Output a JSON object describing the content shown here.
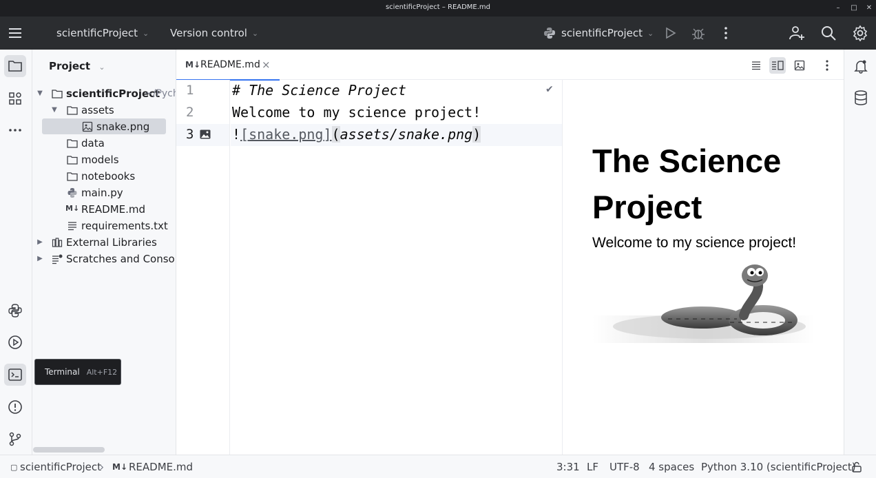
{
  "window": {
    "title": "scientificProject – README.md"
  },
  "toolbar": {
    "project_name": "scientificProject",
    "vcs_label": "Version control",
    "run_config": "scientificProject"
  },
  "project_panel": {
    "title": "Project",
    "root_name": "scientificProject",
    "root_path": "~/PycharmProjects/scientificProject",
    "items": [
      {
        "label": "assets",
        "type": "folder"
      },
      {
        "label": "snake.png",
        "type": "image"
      },
      {
        "label": "data",
        "type": "folder"
      },
      {
        "label": "models",
        "type": "folder"
      },
      {
        "label": "notebooks",
        "type": "folder"
      },
      {
        "label": "main.py",
        "type": "python"
      },
      {
        "label": "README.md",
        "type": "markdown"
      },
      {
        "label": "requirements.txt",
        "type": "text"
      },
      {
        "label": "External Libraries",
        "type": "libraries"
      },
      {
        "label": "Scratches and Consoles",
        "type": "scratches"
      }
    ]
  },
  "editor": {
    "tab_mark": "M↓",
    "tab_label": "README.md",
    "line_numbers": [
      "1",
      "2",
      "3"
    ],
    "lines": {
      "l1": "# The Science Project",
      "l2": "Welcome to my science project!",
      "l3_bang": "!",
      "l3_open": "[",
      "l3_text": "snake.png",
      "l3_close": "]",
      "l3_po": "(",
      "l3_url": "assets/snake.png",
      "l3_pc": ")"
    }
  },
  "preview": {
    "heading": "The Science Project",
    "paragraph": "Welcome to my science project!"
  },
  "tooltip": {
    "label": "Terminal",
    "shortcut": "Alt+F12"
  },
  "statusbar": {
    "crumb_project": "scientificProject",
    "crumb_file_mark": "M↓",
    "crumb_file": "README.md",
    "position": "3:31",
    "line_sep": "LF",
    "encoding": "UTF-8",
    "indent": "4 spaces",
    "interpreter": "Python 3.10 (scientificProject)"
  },
  "colors": {
    "accent": "#3574f0",
    "toolbar_bg": "#2b2d30",
    "title_bg": "#1e1f22",
    "panel_bg": "#f7f8fa"
  },
  "icons": [
    "hamburger-icon",
    "chevron-down-icon",
    "python-icon",
    "run-icon",
    "debug-icon",
    "more-vertical-icon",
    "add-user-icon",
    "search-icon",
    "gear-icon",
    "folder-icon",
    "structure-icon",
    "more-horizontal-icon",
    "python-console-icon",
    "services-icon",
    "terminal-icon",
    "problems-icon",
    "git-icon",
    "bell-icon",
    "database-icon",
    "lock-icon",
    "close-icon",
    "check-icon",
    "image-icon"
  ]
}
